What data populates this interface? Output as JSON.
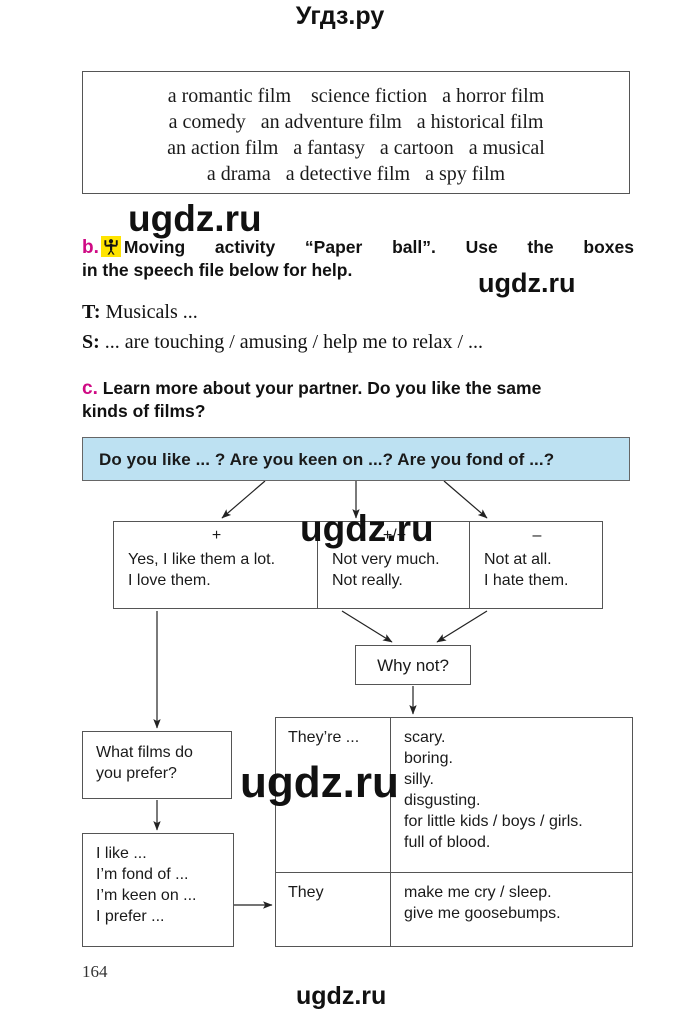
{
  "site": {
    "header_logo": "Угдз.ру",
    "watermark": "ugdz.ru"
  },
  "page": {
    "number": "164"
  },
  "vocab_box": {
    "lines": [
      "a romantic film    science fiction   a horror film",
      "a comedy   an adventure film   a historical film",
      "an action film   a fantasy   a cartoon   a musical",
      "a drama   a detective film   a spy film"
    ]
  },
  "task_b": {
    "label": "b.",
    "icon": "moving-activity-icon",
    "text_line1": "Moving activity “Paper ball”. Use the boxes",
    "text_line2": "in the speech file below for help.",
    "dialog": [
      {
        "speaker": "T:",
        "text": " Musicals ..."
      },
      {
        "speaker": "S:",
        "text": " ... are touching / amusing / help me to relax / ..."
      }
    ]
  },
  "task_c": {
    "label": "c.",
    "text_line1": "Learn more about your partner. Do you like the same",
    "text_line2": "kinds of films?"
  },
  "flowchart": {
    "question_box": {
      "text": "Do you like ... ?  Are you keen on ...?  Are you fond of ...?",
      "bg_color": "#bde1f2"
    },
    "answers": [
      {
        "sign": "+",
        "lines": [
          "Yes, I like them a lot.",
          "I love them."
        ]
      },
      {
        "sign": "+/−",
        "lines": [
          "Not very much.",
          "Not really."
        ]
      },
      {
        "sign": "–",
        "lines": [
          "Not at all.",
          "I hate them."
        ]
      }
    ],
    "why_box": {
      "text": "Why not?"
    },
    "what_box": {
      "lines": [
        "What films do",
        "you prefer?"
      ]
    },
    "ilike_box": {
      "lines": [
        "I like ...",
        "I’m fond of ...",
        "I’m keen on ...",
        "I prefer ..."
      ]
    },
    "they_table": {
      "rows": [
        {
          "subject": "They’re ...",
          "items": [
            "scary.",
            "boring.",
            "silly.",
            "disgusting.",
            "for little kids / boys / girls.",
            "full of blood."
          ]
        },
        {
          "subject": "They",
          "items": [
            "make me cry / sleep.",
            "give me goosebumps."
          ]
        }
      ]
    }
  }
}
